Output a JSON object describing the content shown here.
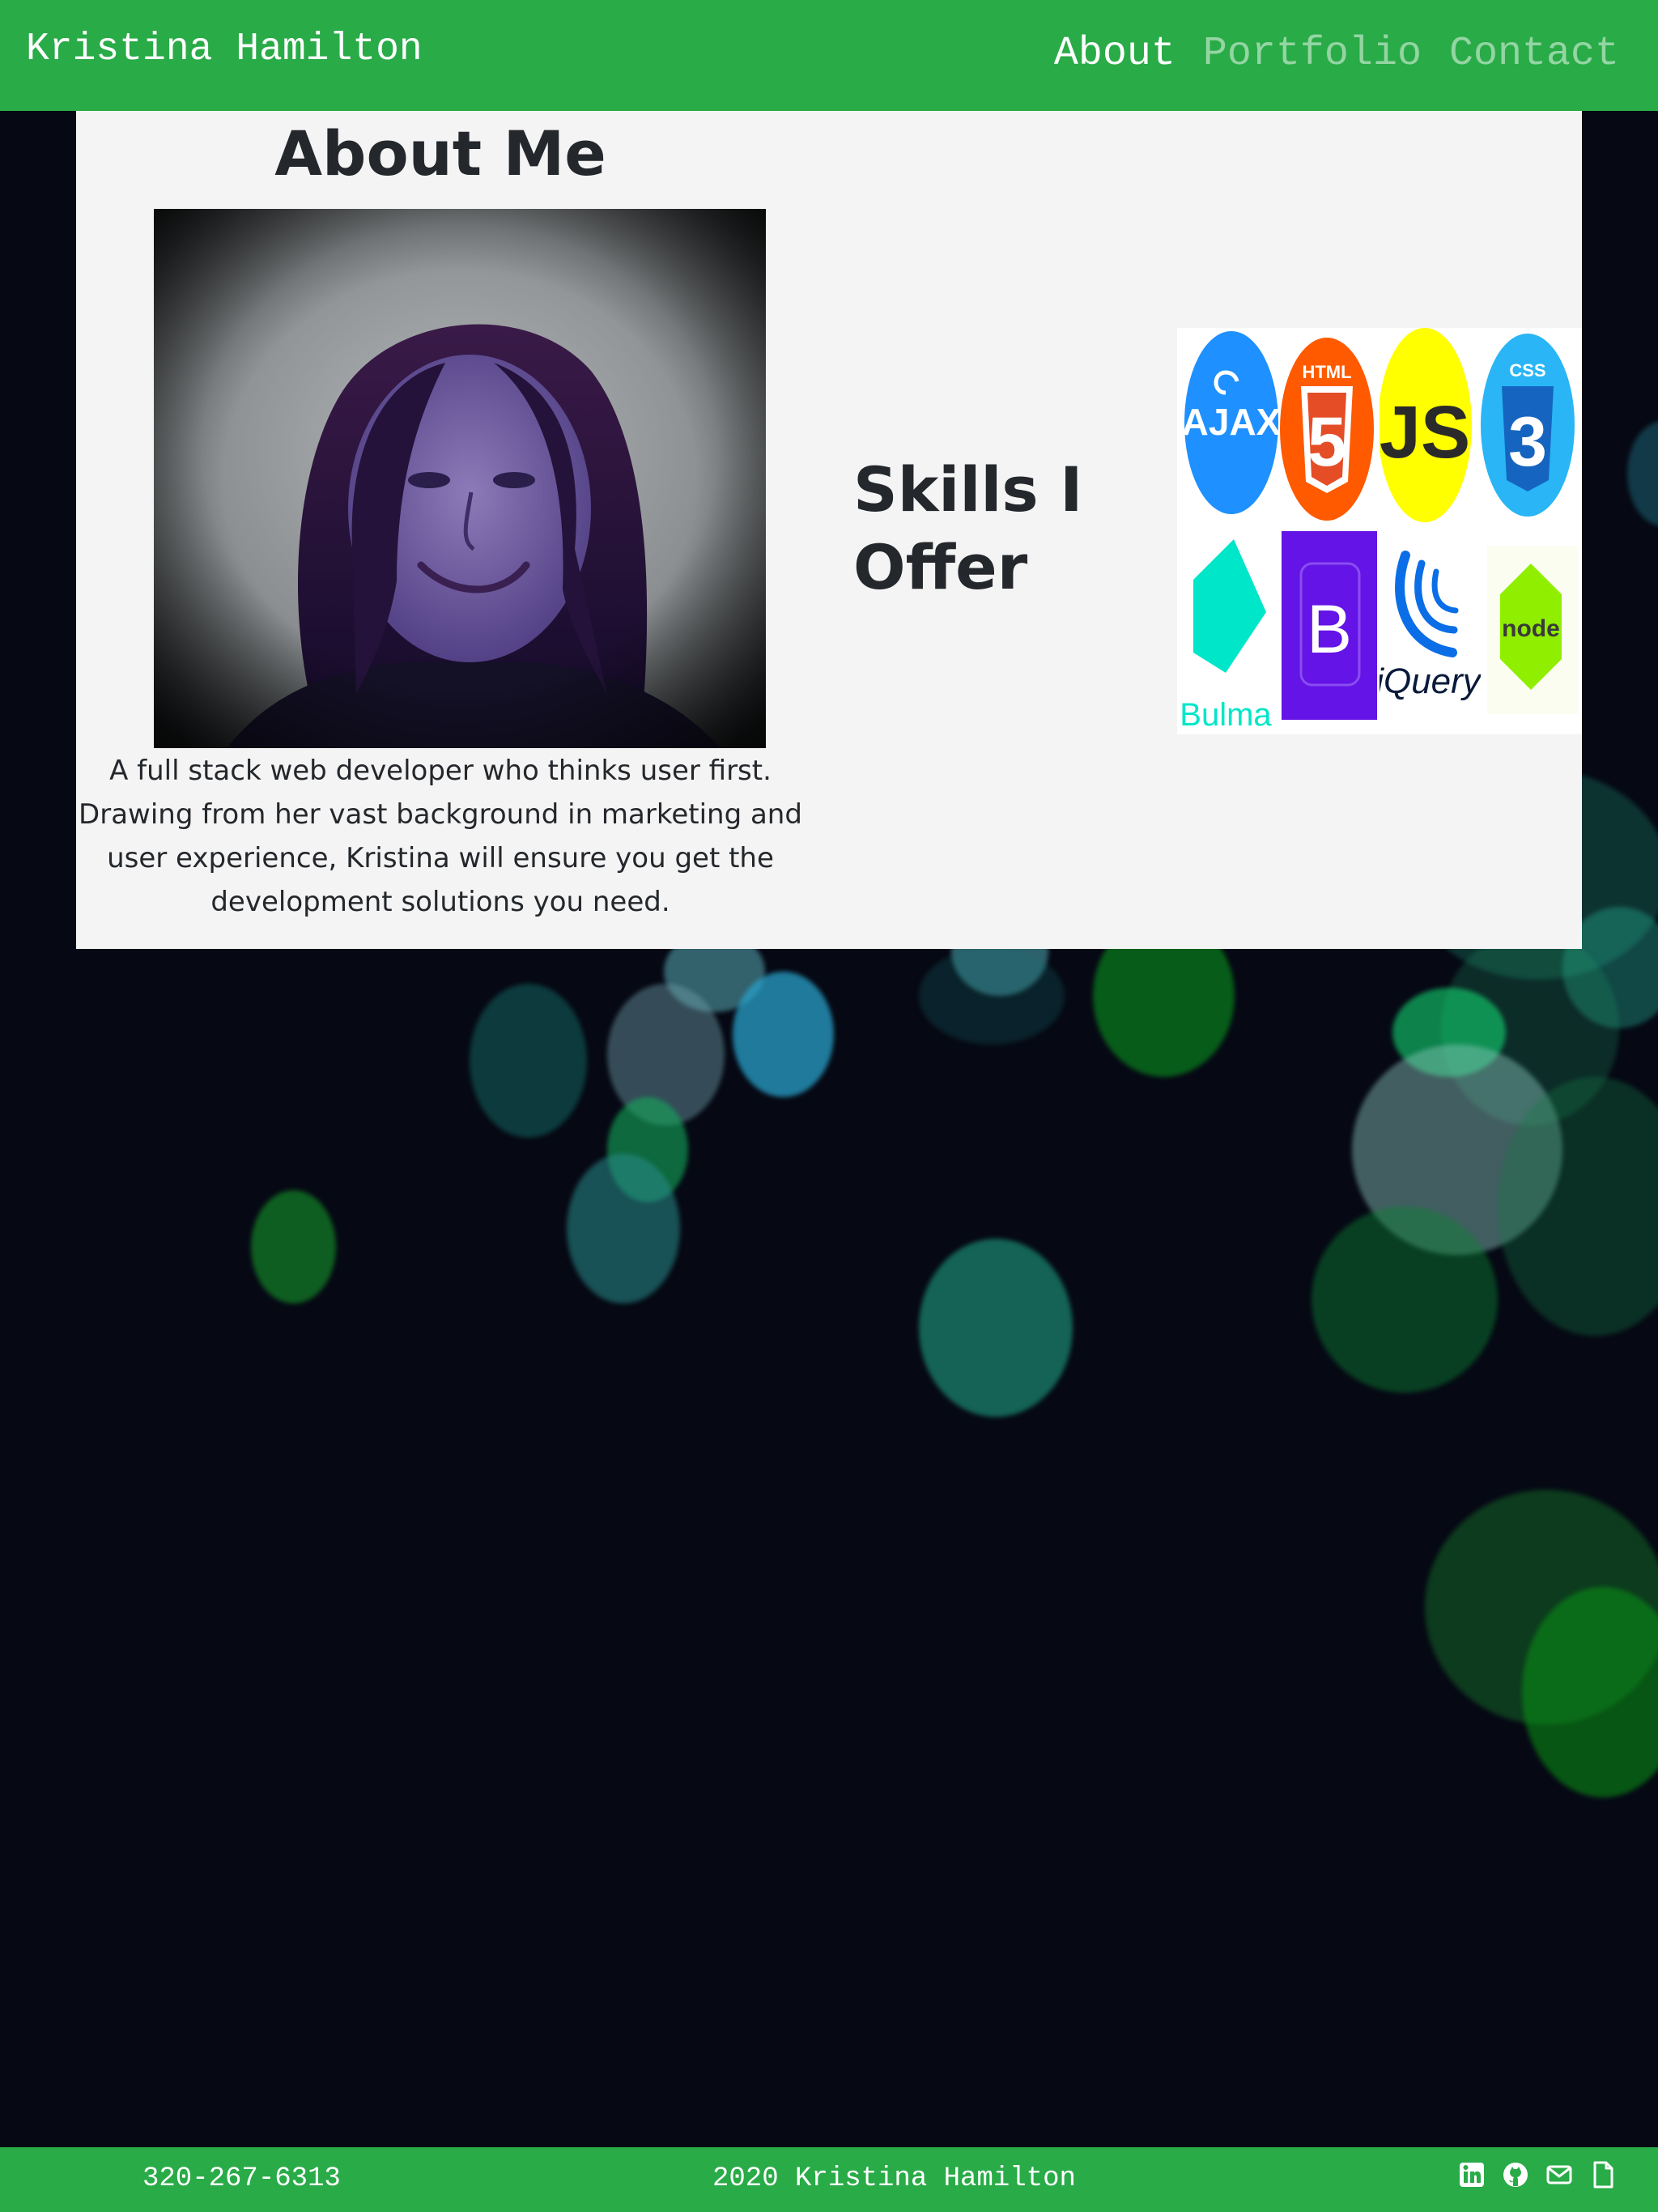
{
  "header": {
    "brand": "Kristina Hamilton",
    "nav": [
      {
        "label": "About",
        "active": true
      },
      {
        "label": "Portfolio",
        "active": false
      },
      {
        "label": "Contact",
        "active": false
      }
    ]
  },
  "about": {
    "title": "About Me",
    "photo_icon": "portrait-photo",
    "description": "A full stack web developer who thinks user first. Drawing from her vast background in marketing and user experience, Kristina will ensure you get the development solutions you need."
  },
  "skills": {
    "title": "Skills I Offer",
    "logos": [
      {
        "name": "ajax-logo",
        "text": "AJAX",
        "color": "#1e90ff"
      },
      {
        "name": "html5-logo",
        "text": "HTML",
        "color": "#ff5a00"
      },
      {
        "name": "js-logo",
        "text": "JS",
        "color": "#ffff00"
      },
      {
        "name": "css3-logo",
        "text": "CSS",
        "color": "#29b5f6"
      },
      {
        "name": "bulma-logo",
        "text": "Bulma",
        "color": "#00e6c8"
      },
      {
        "name": "bootstrap-logo",
        "text": "B",
        "color": "#6414e6"
      },
      {
        "name": "jquery-logo",
        "text": "jQuery",
        "color": "#0b6ee6"
      },
      {
        "name": "node-logo",
        "text": "node",
        "color": "#90ef00"
      }
    ]
  },
  "footer": {
    "phone": "320-267-6313",
    "copyright": "2020 Kristina Hamilton",
    "icons": [
      "linkedin-icon",
      "github-icon",
      "email-icon",
      "resume-icon"
    ]
  },
  "colors": {
    "brand_green": "#29ab47",
    "card_bg": "#f4f4f4",
    "page_bg": "#060914",
    "text_dark": "#24272b"
  }
}
